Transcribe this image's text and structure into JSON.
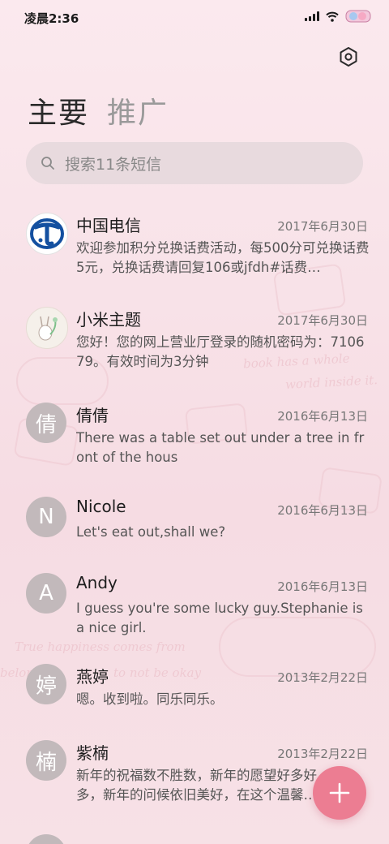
{
  "status_bar": {
    "time": "凌晨2:36",
    "icons": [
      "signal-icon",
      "wifi-icon",
      "theme-badge-icon"
    ]
  },
  "header": {
    "settings_icon": "settings-icon",
    "tabs": [
      {
        "label": "主要",
        "active": true
      },
      {
        "label": "推广",
        "active": false
      }
    ]
  },
  "search": {
    "icon": "search-icon",
    "placeholder": "搜索11条短信"
  },
  "messages": [
    {
      "avatar": "china-telecom-logo",
      "name": "中国电信",
      "date": "2017年6月30日",
      "preview": "欢迎参加积分兑换话费活动，每500分可兑换话费5元，兑换话费请回复106或jfdh#话费…"
    },
    {
      "avatar": "xiaomi-theme-avatar",
      "name": "小米主题",
      "date": "2017年6月30日",
      "preview": "您好！您的网上营业厅登录的随机密码为：710679。有效时间为3分钟"
    },
    {
      "avatar_text": "倩",
      "name": "倩倩",
      "date": "2016年6月13日",
      "preview": "There was a table set out under a tree in front of the hous"
    },
    {
      "avatar_text": "N",
      "name": "Nicole",
      "date": "2016年6月13日",
      "preview": "Let's eat out,shall we?"
    },
    {
      "avatar_text": "A",
      "name": "Andy",
      "date": "2016年6月13日",
      "preview": "I guess you're some lucky guy.Stephanie is a nice girl."
    },
    {
      "avatar_text": "婷",
      "name": "燕婷",
      "date": "2013年2月22日",
      "preview": "嗯。收到啦。同乐同乐。"
    },
    {
      "avatar_text": "楠",
      "name": "紫楠",
      "date": "2013年2月22日",
      "preview": "新年的祝福数不胜数，新年的愿望好多好多，新年的问候依旧美好，在这个温馨的时刻"
    }
  ],
  "fab": {
    "icon": "plus-icon"
  },
  "wallpaper_text": [
    "book has a whole",
    "world inside it.",
    "True happiness comes from",
    "belonging",
    "to not be okay"
  ],
  "colors": {
    "accent": "#ec7d92",
    "avatar_grey": "#c2b9bb",
    "background": "#f8e2e8"
  }
}
